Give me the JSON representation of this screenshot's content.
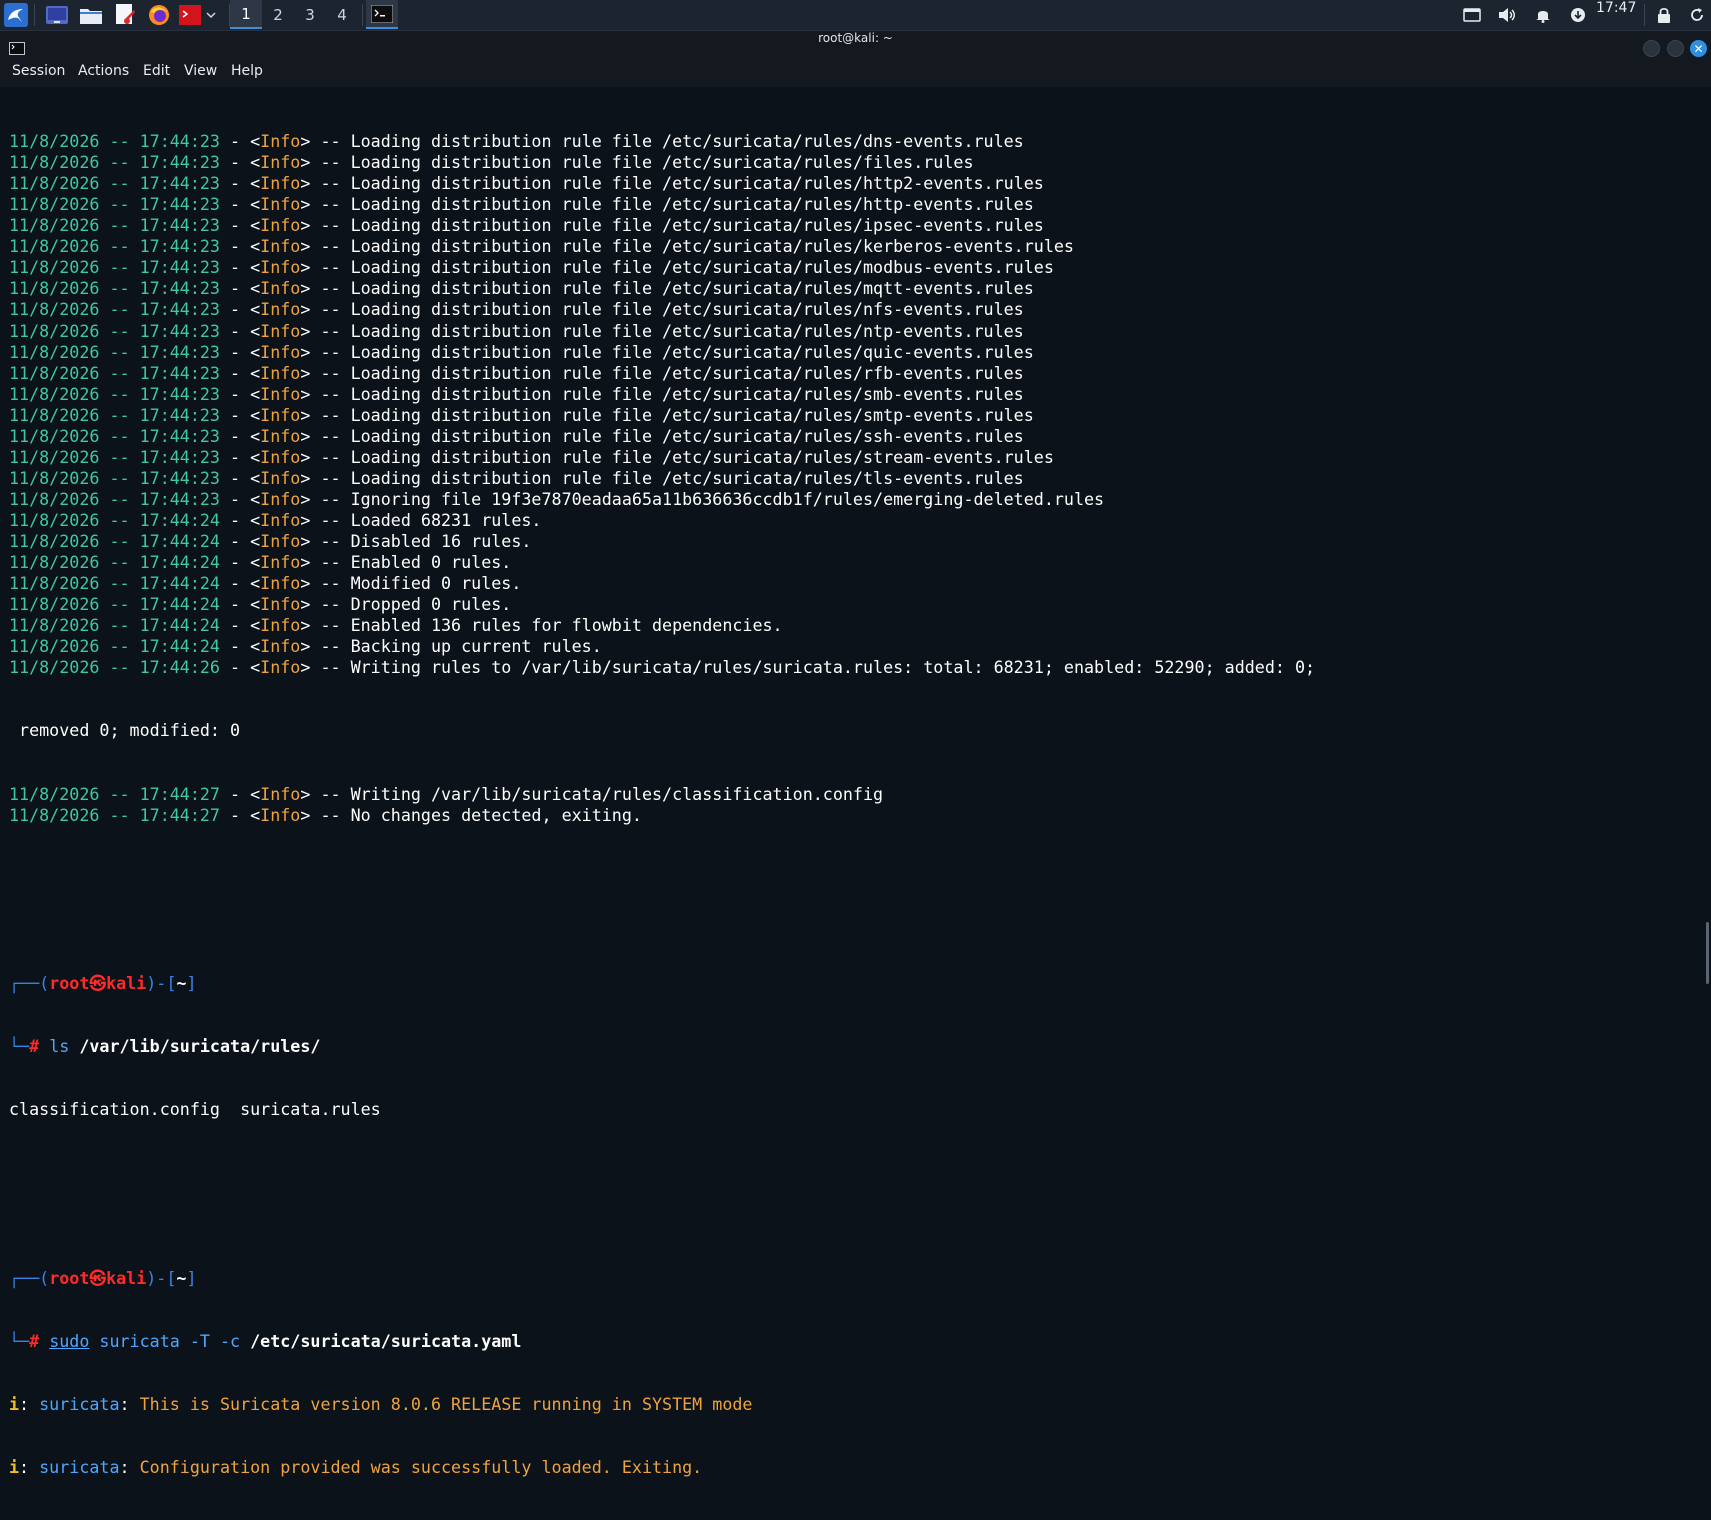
{
  "panel": {
    "workspaces": [
      "1",
      "2",
      "3",
      "4"
    ],
    "active_workspace": "1",
    "clock": "17:47"
  },
  "window": {
    "title": "root@kali: ~",
    "menu": [
      "Session",
      "Actions",
      "Edit",
      "View",
      "Help"
    ]
  },
  "terminal": {
    "log_lines": [
      {
        "date": "11/8/2026",
        "time": "17:44:23",
        "level": "Info",
        "msg": "Loading distribution rule file /etc/suricata/rules/dns-events.rules"
      },
      {
        "date": "11/8/2026",
        "time": "17:44:23",
        "level": "Info",
        "msg": "Loading distribution rule file /etc/suricata/rules/files.rules"
      },
      {
        "date": "11/8/2026",
        "time": "17:44:23",
        "level": "Info",
        "msg": "Loading distribution rule file /etc/suricata/rules/http2-events.rules"
      },
      {
        "date": "11/8/2026",
        "time": "17:44:23",
        "level": "Info",
        "msg": "Loading distribution rule file /etc/suricata/rules/http-events.rules"
      },
      {
        "date": "11/8/2026",
        "time": "17:44:23",
        "level": "Info",
        "msg": "Loading distribution rule file /etc/suricata/rules/ipsec-events.rules"
      },
      {
        "date": "11/8/2026",
        "time": "17:44:23",
        "level": "Info",
        "msg": "Loading distribution rule file /etc/suricata/rules/kerberos-events.rules"
      },
      {
        "date": "11/8/2026",
        "time": "17:44:23",
        "level": "Info",
        "msg": "Loading distribution rule file /etc/suricata/rules/modbus-events.rules"
      },
      {
        "date": "11/8/2026",
        "time": "17:44:23",
        "level": "Info",
        "msg": "Loading distribution rule file /etc/suricata/rules/mqtt-events.rules"
      },
      {
        "date": "11/8/2026",
        "time": "17:44:23",
        "level": "Info",
        "msg": "Loading distribution rule file /etc/suricata/rules/nfs-events.rules"
      },
      {
        "date": "11/8/2026",
        "time": "17:44:23",
        "level": "Info",
        "msg": "Loading distribution rule file /etc/suricata/rules/ntp-events.rules"
      },
      {
        "date": "11/8/2026",
        "time": "17:44:23",
        "level": "Info",
        "msg": "Loading distribution rule file /etc/suricata/rules/quic-events.rules"
      },
      {
        "date": "11/8/2026",
        "time": "17:44:23",
        "level": "Info",
        "msg": "Loading distribution rule file /etc/suricata/rules/rfb-events.rules"
      },
      {
        "date": "11/8/2026",
        "time": "17:44:23",
        "level": "Info",
        "msg": "Loading distribution rule file /etc/suricata/rules/smb-events.rules"
      },
      {
        "date": "11/8/2026",
        "time": "17:44:23",
        "level": "Info",
        "msg": "Loading distribution rule file /etc/suricata/rules/smtp-events.rules"
      },
      {
        "date": "11/8/2026",
        "time": "17:44:23",
        "level": "Info",
        "msg": "Loading distribution rule file /etc/suricata/rules/ssh-events.rules"
      },
      {
        "date": "11/8/2026",
        "time": "17:44:23",
        "level": "Info",
        "msg": "Loading distribution rule file /etc/suricata/rules/stream-events.rules"
      },
      {
        "date": "11/8/2026",
        "time": "17:44:23",
        "level": "Info",
        "msg": "Loading distribution rule file /etc/suricata/rules/tls-events.rules"
      },
      {
        "date": "11/8/2026",
        "time": "17:44:23",
        "level": "Info",
        "msg": "Ignoring file 19f3e7870eadaa65a11b636636ccdb1f/rules/emerging-deleted.rules"
      },
      {
        "date": "11/8/2026",
        "time": "17:44:24",
        "level": "Info",
        "msg": "Loaded 68231 rules."
      },
      {
        "date": "11/8/2026",
        "time": "17:44:24",
        "level": "Info",
        "msg": "Disabled 16 rules."
      },
      {
        "date": "11/8/2026",
        "time": "17:44:24",
        "level": "Info",
        "msg": "Enabled 0 rules."
      },
      {
        "date": "11/8/2026",
        "time": "17:44:24",
        "level": "Info",
        "msg": "Modified 0 rules."
      },
      {
        "date": "11/8/2026",
        "time": "17:44:24",
        "level": "Info",
        "msg": "Dropped 0 rules."
      },
      {
        "date": "11/8/2026",
        "time": "17:44:24",
        "level": "Info",
        "msg": "Enabled 136 rules for flowbit dependencies."
      },
      {
        "date": "11/8/2026",
        "time": "17:44:24",
        "level": "Info",
        "msg": "Backing up current rules."
      },
      {
        "date": "11/8/2026",
        "time": "17:44:26",
        "level": "Info",
        "msg": "Writing rules to /var/lib/suricata/rules/suricata.rules: total: 68231; enabled: 52290; added: 0;"
      }
    ],
    "wrap_line": " removed 0; modified: 0",
    "log_lines_after": [
      {
        "date": "11/8/2026",
        "time": "17:44:27",
        "level": "Info",
        "msg": "Writing /var/lib/suricata/rules/classification.config"
      },
      {
        "date": "11/8/2026",
        "time": "17:44:27",
        "level": "Info",
        "msg": "No changes detected, exiting."
      }
    ],
    "prompt": {
      "user": "root",
      "symbol": "㉿",
      "host": "kali",
      "dir": "~"
    },
    "cmd1": {
      "name": "ls",
      "arg": "/var/lib/suricata/rules/"
    },
    "cmd1_output": "classification.config  suricata.rules",
    "cmd2": {
      "sudo": "sudo",
      "name": "suricata",
      "flags": "-T -c",
      "arg": "/etc/suricata/suricata.yaml"
    },
    "cmd2_output": [
      {
        "prefix": "i",
        "src": "suricata",
        "msg": "This is Suricata version 8.0.6 RELEASE running in SYSTEM mode"
      },
      {
        "prefix": "i",
        "src": "suricata",
        "msg": "Configuration provided was successfully loaded. Exiting."
      }
    ]
  }
}
